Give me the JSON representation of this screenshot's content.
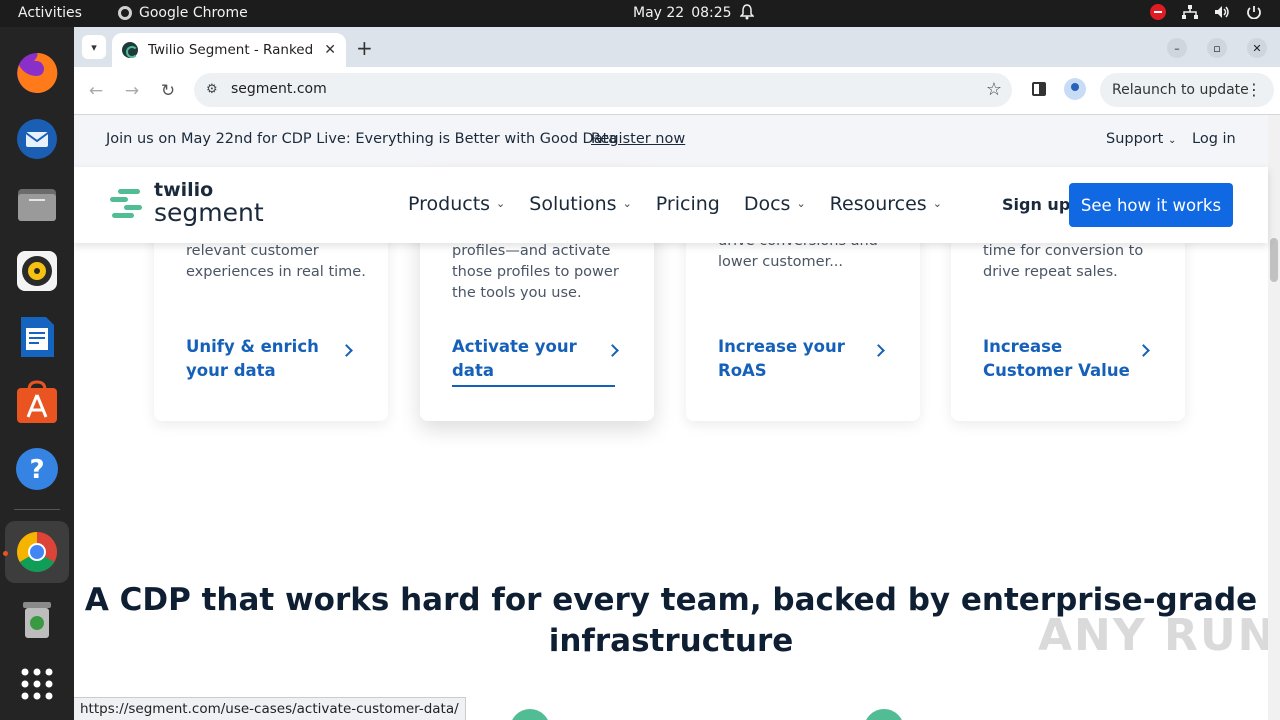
{
  "system": {
    "activities": "Activities",
    "app_name": "Google Chrome",
    "date": "May 22",
    "time": "08:25"
  },
  "dock": {
    "items": [
      {
        "name": "firefox",
        "color": "#e66000"
      },
      {
        "name": "thunderbird",
        "color": "#0a84ff"
      },
      {
        "name": "files",
        "color": "#8c8c8c"
      },
      {
        "name": "rhythmbox",
        "color": "#f0c419"
      },
      {
        "name": "libreoffice-writer",
        "color": "#1e6fb8"
      },
      {
        "name": "app-center",
        "color": "#e95420"
      },
      {
        "name": "help",
        "color": "#2b8cd6"
      },
      {
        "name": "chrome",
        "color": "#4285f4"
      },
      {
        "name": "trash",
        "color": "#6f8f6f"
      },
      {
        "name": "show-apps",
        "color": "#ffffff"
      }
    ]
  },
  "browser": {
    "tab_title": "Twilio Segment - Ranked",
    "url": "segment.com",
    "relaunch_label": "Relaunch to update",
    "status_url": "https://segment.com/use-cases/activate-customer-data/"
  },
  "announcement": {
    "message": "Join us on May 22nd for CDP Live: Everything is Better with Good Data",
    "register": "Register now",
    "support": "Support",
    "login": "Log in"
  },
  "nav": {
    "logo_top": "twilio",
    "logo_bottom": "segment",
    "links": [
      "Products",
      "Solutions",
      "Pricing",
      "Docs",
      "Resources"
    ],
    "signup": "Sign up",
    "cta": "See how it works"
  },
  "cards": [
    {
      "desc": "relevant customer experiences in real time.",
      "cta": "Unify & enrich your data"
    },
    {
      "desc": "profiles—and activate those profiles to power the tools you use.",
      "cta": "Activate your data"
    },
    {
      "desc": "drive conversions and lower customer...",
      "cta": "Increase your RoAS"
    },
    {
      "desc": "time for conversion to drive repeat sales.",
      "cta": "Increase Customer Value"
    }
  ],
  "headline": "A CDP that works hard for every team, backed by enterprise-grade infrastructure",
  "watermark": "ANY RUN",
  "colors": {
    "brand_green": "#52bd94",
    "cta_blue": "#1168e3",
    "link_blue": "#1560b8"
  }
}
